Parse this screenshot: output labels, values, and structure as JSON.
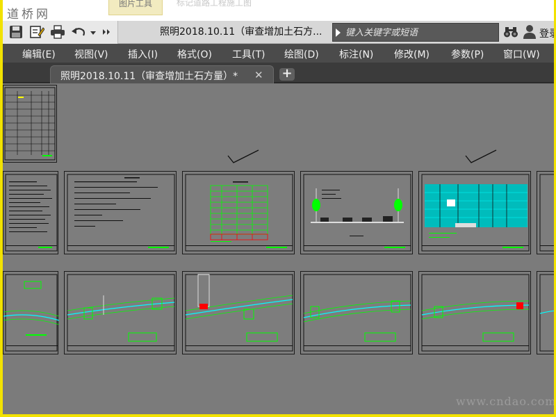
{
  "logo_text": "道桥网",
  "ribbon": {
    "tab_active": "图片工具",
    "tab_other": "标记道路工程施工图"
  },
  "document": {
    "title_short": "照明2018.10.11（审查增加土石方...",
    "tab_label": "照明2018.10.11（审查增加土石方量）*"
  },
  "search": {
    "placeholder": "键入关键字或短语"
  },
  "account": {
    "login_label": "登录"
  },
  "menu": [
    "编辑(E)",
    "视图(V)",
    "插入(I)",
    "格式(O)",
    "工具(T)",
    "绘图(D)",
    "标注(N)",
    "修改(M)",
    "参数(P)",
    "窗口(W)"
  ],
  "icons": [
    "save-icon",
    "edit-icon",
    "print-icon",
    "undo-icon",
    "dropdown-icon",
    "more-icon",
    "binoculars-icon",
    "user-icon",
    "close-icon",
    "add-tab-icon"
  ],
  "colors": {
    "canvas": "#7b7b7b",
    "menubar": "#4b4b4b",
    "accent_green": "#00ff00",
    "accent_cyan": "#00ffff",
    "accent_red": "#ff0000",
    "frame_yellow": "#f2e200"
  },
  "watermark": "www.cndao.com"
}
